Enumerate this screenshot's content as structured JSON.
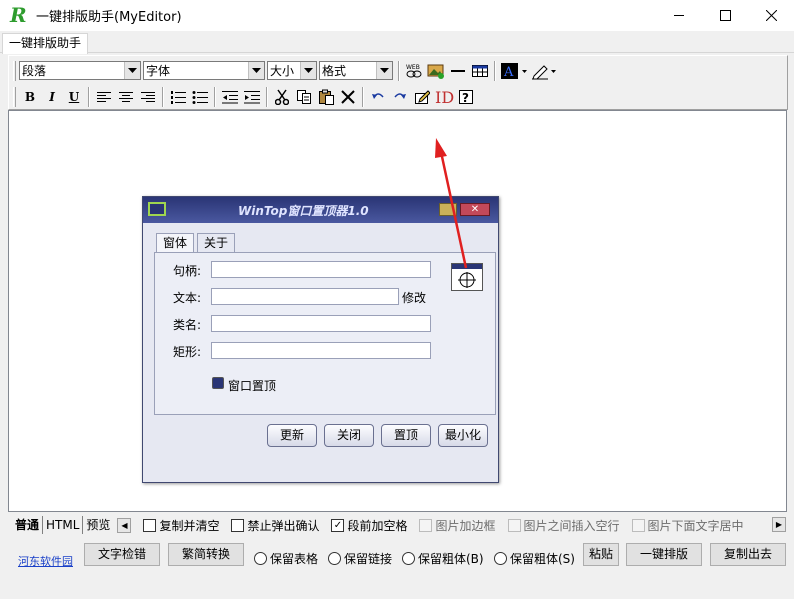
{
  "window": {
    "title": "一键排版助手(MyEditor)",
    "controls": [
      "minimize",
      "maximize",
      "close"
    ]
  },
  "tabs": [
    {
      "label": "一键排版助手",
      "active": true
    }
  ],
  "toolbar": {
    "paragraph_combo": "段落",
    "font_combo": "字体",
    "size_combo": "大小",
    "format_combo": "格式",
    "row1_icons": [
      "web-link-icon",
      "insert-image-icon",
      "horizontal-rule-icon",
      "insert-table-icon",
      "font-color-icon",
      "highlight-pen-icon"
    ],
    "bold": "B",
    "italic": "I",
    "underline": "U",
    "row2_icons": [
      "align-left-icon",
      "align-center-icon",
      "align-right-icon",
      "numbered-list-icon",
      "bullet-list-icon",
      "outdent-icon",
      "indent-icon",
      "cut-icon",
      "copy-icon",
      "paste-icon",
      "delete-icon",
      "undo-icon",
      "redo-icon",
      "edit-note-icon",
      "id-icon",
      "help-icon"
    ]
  },
  "embedded_dialog": {
    "title": "WinTop窗口置顶器1.0",
    "tabs": [
      "窗体",
      "关于"
    ],
    "fields": [
      "句柄:",
      "文本:",
      "类名:",
      "矩形:"
    ],
    "modify_label": "修改",
    "checkbox_label": "窗口置顶",
    "buttons": [
      "更新",
      "关闭",
      "置顶",
      "最小化"
    ]
  },
  "view_tabs": [
    "普通",
    "HTML",
    "预览"
  ],
  "options": [
    {
      "label": "复制并清空",
      "checked": false,
      "enabled": true
    },
    {
      "label": "禁止弹出确认",
      "checked": false,
      "enabled": true
    },
    {
      "label": "段前加空格",
      "checked": true,
      "enabled": true
    },
    {
      "label": "图片加边框",
      "checked": false,
      "enabled": false
    },
    {
      "label": "图片之间插入空行",
      "checked": false,
      "enabled": false
    },
    {
      "label": "图片下面文字居中",
      "checked": false,
      "enabled": false
    }
  ],
  "actions": {
    "link": "河东软件园",
    "text_check": "文字检错",
    "convert": "繁简转换",
    "radios": [
      "保留表格",
      "保留链接",
      "保留粗体(B)",
      "保留粗体(S)"
    ],
    "paste": "粘贴",
    "one_click": "一键排版",
    "copy_out": "复制出去"
  },
  "colors": {
    "arrow": "#e02020",
    "link": "#1a40c8",
    "dialog_title": "#2a3575",
    "logo": "#2e9c2e"
  }
}
